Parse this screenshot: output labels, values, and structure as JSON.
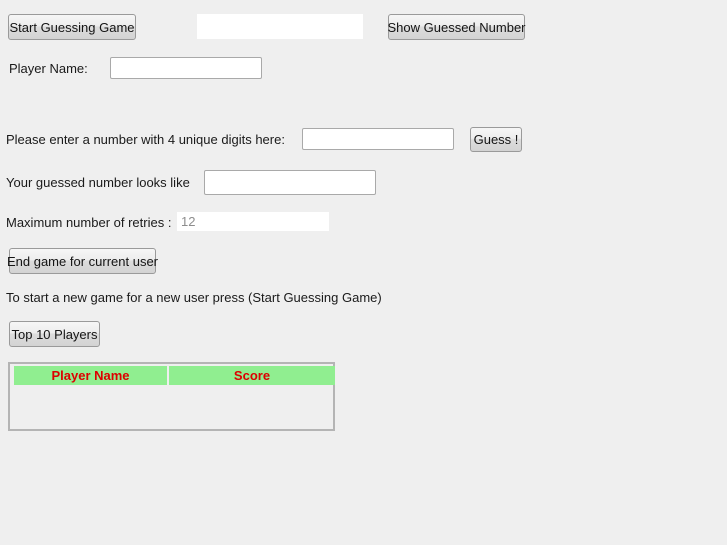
{
  "page": {
    "background_color": "#efefef",
    "text_color": "#1a1a1a"
  },
  "toolbar": {
    "start_game_label": "Start Guessing Game",
    "show_guessed_number_label": "Show Guessed Number",
    "guessed_number_display_value": ""
  },
  "player": {
    "name_label": "Player Name:",
    "name_value": "",
    "name_placeholder": ""
  },
  "guess": {
    "prompt_label": "Please enter a number with 4 unique digits here:",
    "input_value": "",
    "input_placeholder": "",
    "button_label": "Guess !"
  },
  "result": {
    "looks_like_label": "Your guessed number looks like",
    "looks_like_value": "",
    "looks_like_placeholder": ""
  },
  "retries": {
    "label": "Maximum number of retries :",
    "value": "",
    "placeholder": "12"
  },
  "controls": {
    "end_game_label": "End game for current user",
    "hint_text": "To start a new game for a new user press (Start Guessing Game)",
    "top_players_label": "Top 10 Players"
  },
  "leaderboard": {
    "columns": [
      "Player Name",
      "Score"
    ],
    "header_background": "#90ee90",
    "header_text_color": "#dd0000",
    "rows": []
  }
}
